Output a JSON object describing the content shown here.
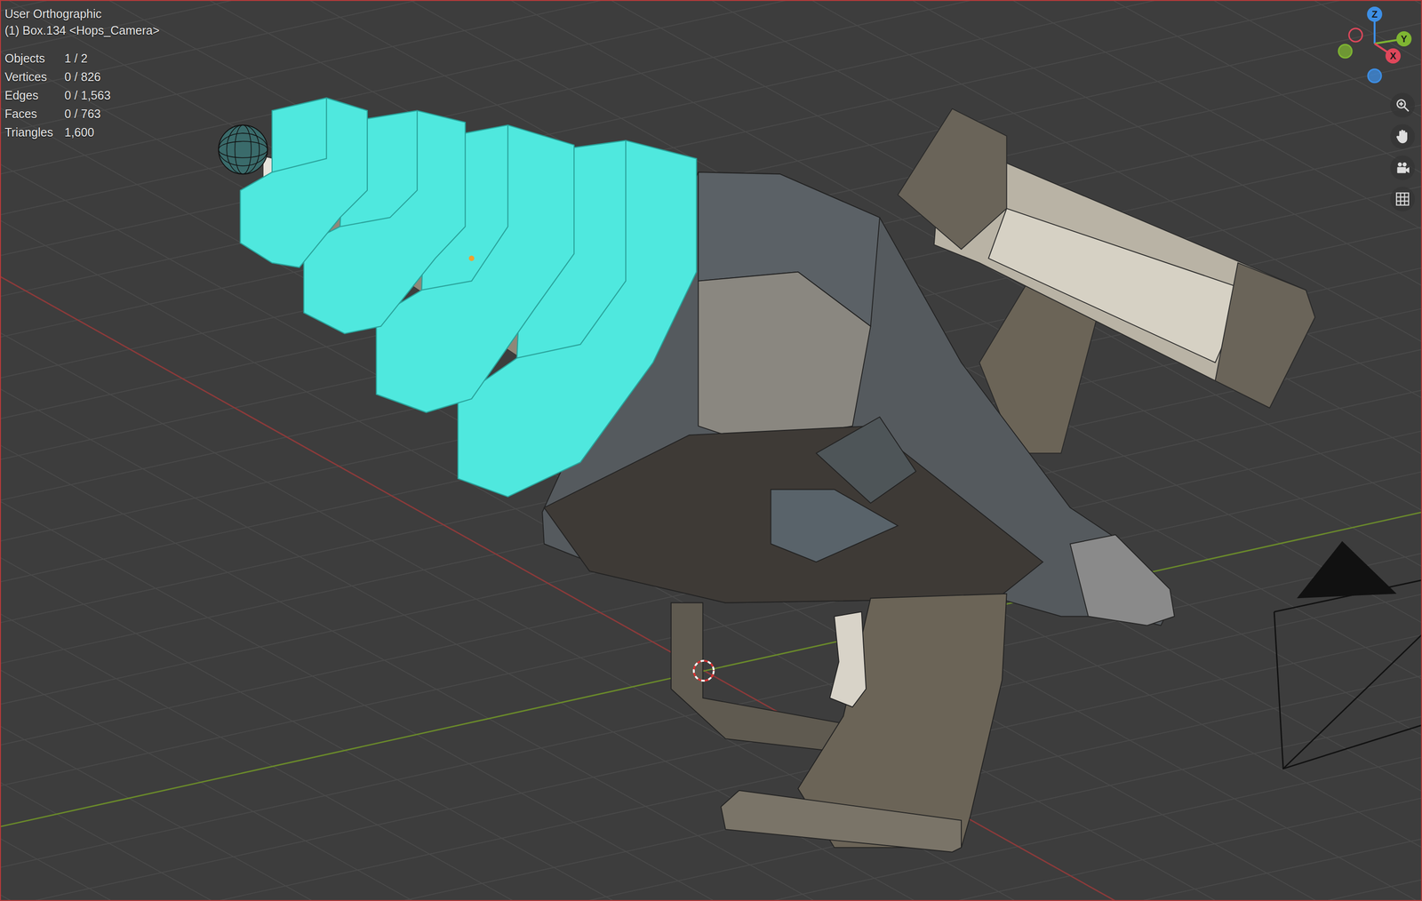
{
  "viewport": {
    "view": "User Orthographic",
    "object": "(1) Box.134 <Hops_Camera>"
  },
  "stats": [
    {
      "label": "Objects",
      "value": "1 / 2"
    },
    {
      "label": "Vertices",
      "value": "0 / 826"
    },
    {
      "label": "Edges",
      "value": "0 / 1,563"
    },
    {
      "label": "Faces",
      "value": "0 / 763"
    },
    {
      "label": "Triangles",
      "value": "1,600"
    }
  ],
  "gizmo": [
    {
      "label": "Z",
      "color": "#3d8fe6"
    },
    {
      "label": "Y",
      "color": "#7fb532"
    },
    {
      "label": "X",
      "color": "#e0475b"
    }
  ]
}
